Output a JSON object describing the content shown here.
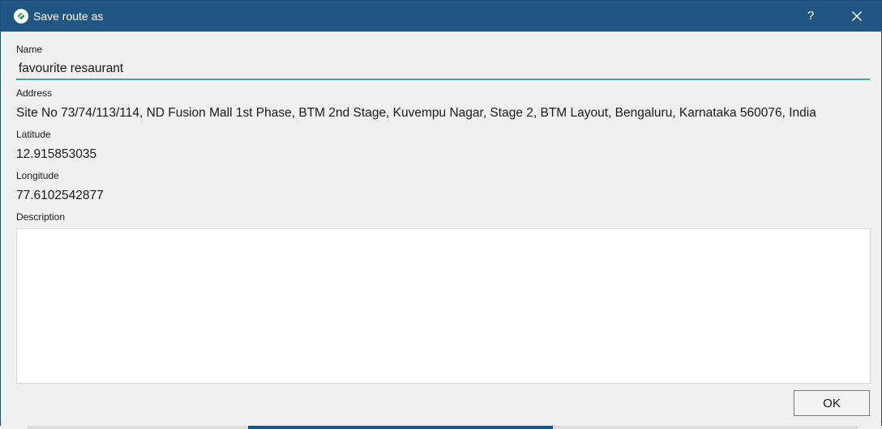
{
  "window": {
    "title": "Save route as",
    "help_label": "?",
    "accent_color": "#215582"
  },
  "form": {
    "name_label": "Name",
    "name_value": "favourite resaurant",
    "address_label": "Address",
    "address_value": "Site No 73/74/113/114, ND Fusion Mall 1st Phase, BTM 2nd Stage, Kuvempu Nagar, Stage 2, BTM Layout, Bengaluru, Karnataka 560076, India",
    "latitude_label": "Latitude",
    "latitude_value": "12.915853035",
    "longitude_label": "Longitude",
    "longitude_value": "77.6102542877",
    "description_label": "Description",
    "description_value": ""
  },
  "actions": {
    "ok_label": "OK"
  },
  "icons": {
    "app": "route-app-icon",
    "close": "close-icon"
  }
}
